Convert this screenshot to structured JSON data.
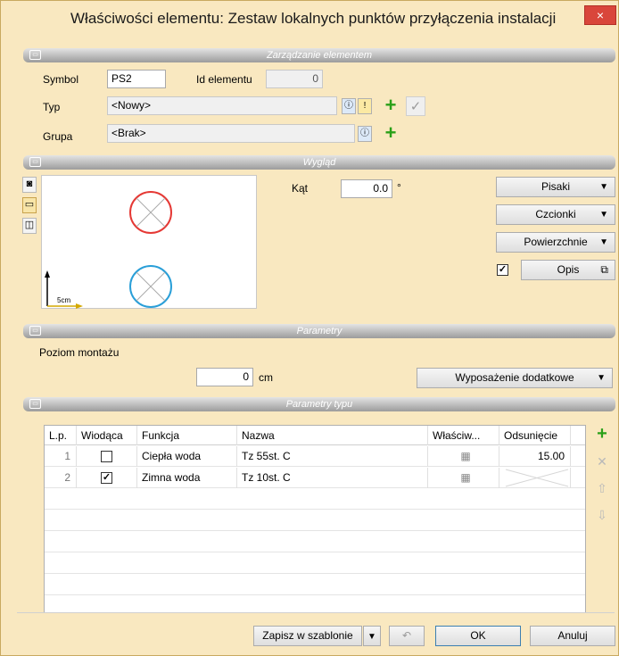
{
  "window": {
    "title": "Właściwości elementu: Zestaw lokalnych punktów przyłączenia instalacji",
    "close": "×"
  },
  "sections": {
    "management": "Zarządzanie elementem",
    "appearance": "Wygląd",
    "parameters": "Parametry",
    "type_parameters": "Parametry typu"
  },
  "management": {
    "symbol_label": "Symbol",
    "symbol_value": "PS2",
    "id_label": "Id elementu",
    "id_value": "0",
    "type_label": "Typ",
    "type_value": "<Nowy>",
    "group_label": "Grupa",
    "group_value": "<Brak>"
  },
  "appearance": {
    "angle_label": "Kąt",
    "angle_value": "0.0",
    "angle_unit": "°",
    "scale_label": "5cm",
    "buttons": {
      "pens": "Pisaki",
      "fonts": "Czcionki",
      "surfaces": "Powierzchnie",
      "description": "Opis"
    },
    "description_checked": true,
    "symbol_colors": {
      "top": "#e53935",
      "bottom": "#2a9fd8"
    }
  },
  "parameters": {
    "mount_level_label": "Poziom montażu",
    "mount_level_value": "0",
    "mount_level_unit": "cm",
    "extra_equipment": "Wyposażenie dodatkowe"
  },
  "table": {
    "headers": [
      "L.p.",
      "Wiodąca",
      "Funkcja",
      "Nazwa",
      "Właściw...",
      "Odsunięcie"
    ],
    "rows": [
      {
        "lp": "1",
        "leading": false,
        "function": "Ciepła woda",
        "name": "Tz 55st. C",
        "offset": "15.00"
      },
      {
        "lp": "2",
        "leading": true,
        "function": "Zimna woda",
        "name": "Tz 10st. C",
        "offset": ""
      }
    ]
  },
  "footer": {
    "save_template": "Zapisz w szablonie",
    "ok": "OK",
    "cancel": "Anuluj"
  },
  "icons": {
    "collapse": "▭",
    "dropdown": "▼",
    "checkmark": "✓",
    "plus": "+",
    "remove": "✕",
    "up": "⇧",
    "down": "⇩",
    "undo": "↶",
    "popup": "⧉"
  }
}
